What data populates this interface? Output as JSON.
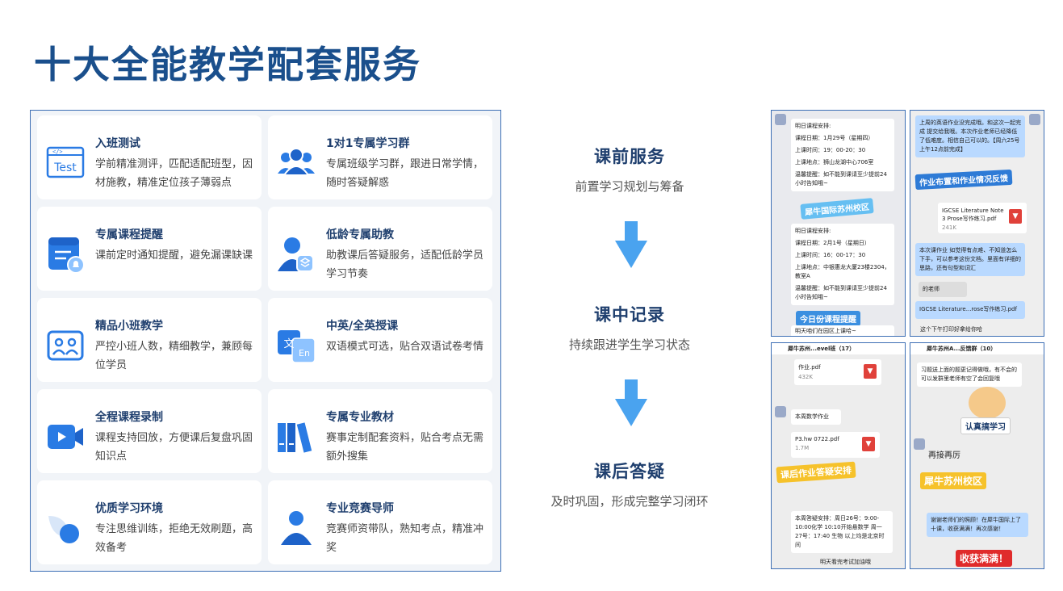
{
  "page": {
    "title": "十大全能教学配套服务"
  },
  "services": [
    {
      "title": "入班测试",
      "desc": "学前精准测评，匹配适配班型，因材施教，精准定位孩子薄弱点",
      "icon": "test-icon",
      "icon_text": "Test"
    },
    {
      "title": "1对1专属学习群",
      "desc": "专属班级学习群，跟进日常学情，随时答疑解惑",
      "icon": "group-icon"
    },
    {
      "title": "专属课程提醒",
      "desc": "课前定时通知提醒，避免漏课缺课",
      "icon": "calendar-bell-icon"
    },
    {
      "title": "低龄专属助教",
      "desc": "助教课后答疑服务，适配低龄学员学习节奏",
      "icon": "assistant-icon"
    },
    {
      "title": "精品小班教学",
      "desc": "严控小班人数，精细教学，兼顾每位学员",
      "icon": "small-class-icon"
    },
    {
      "title": "中英/全英授课",
      "desc": "双语模式可选，贴合双语试卷考情",
      "icon": "bilingual-icon",
      "icon_text_a": "文",
      "icon_text_b": "En"
    },
    {
      "title": "全程课程录制",
      "desc": "课程支持回放，方便课后复盘巩固知识点",
      "icon": "video-icon"
    },
    {
      "title": "专属专业教材",
      "desc": "赛事定制配套资料，贴合考点无需额外搜集",
      "icon": "books-icon"
    },
    {
      "title": "优质学习环境",
      "desc": "专注思维训练，拒绝无效刷题，高效备考",
      "icon": "environment-icon"
    },
    {
      "title": "专业竞赛导师",
      "desc": "竞赛师资带队，熟知考点，精准冲奖",
      "icon": "mentor-icon"
    }
  ],
  "flow": [
    {
      "title": "课前服务",
      "desc": "前置学习规划与筹备"
    },
    {
      "title": "课中记录",
      "desc": "持续跟进学生学习状态"
    },
    {
      "title": "课后答疑",
      "desc": "及时巩固，形成完整学习闭环"
    }
  ],
  "screenshots": {
    "shot1": {
      "msg1_head": "明日课程安排:",
      "msg1_date": "课程日期：1月29号（星期四）",
      "msg1_time": "上课时间：19：00-20：30",
      "msg1_place": "上课地点：狮山龙湖中心706室",
      "msg1_tip": "温馨提醒：如不能到课请至少提前24小时告知哦~",
      "sticker1": "犀牛国际苏州校区",
      "msg2_head": "明日课程安排:",
      "msg2_date": "课程日期：2月1号（星期日）",
      "msg2_time": "上课时间：16：00-17：30",
      "msg2_place": "上课地点：中银惠龙大厦23楼2304，教室A",
      "msg2_tip": "温馨提醒：如不能到课请至少提前24小时告知哦~",
      "sticker2": "今日份课程提醒",
      "footer": "明天咱们在园区上课哈~"
    },
    "shot2": {
      "msg1": "上周的英语作业没完成哦。和这次一起完成 提交给我哦。本次作业老师已经降低了低难度。相信自己可以的。【周六25号上午12点前完成】",
      "sticker": "作业布置和作业情况反馈",
      "file_name": "IGCSE Literature Note 3 Prose写作练习.pdf",
      "file_size": "241K",
      "msg2": "本次课作业 如觉得有点难、不知道怎么下手，可以参考这份文档。里面有详细的思路，还有句型和词汇",
      "msg3": "的老师",
      "file2": "IGCSE Literature...rose写作练习.pdf",
      "footer": "这个下午打印好拿给你哈"
    },
    "shot3": {
      "header": "犀牛苏州...evel班（17）",
      "file1": "作业.pdf",
      "file1_size": "432K",
      "msg1": "本周数学作业",
      "file2": "P3.hw 0722.pdf",
      "file2_size": "1.7M",
      "sticker": "课后作业答疑安排",
      "msg2": "本周答疑安排：周日26号：9:00-10:00化学 10:10开始悬数学 周一27号：17:40 生物 以上均是北京时间",
      "footer": "明天看完考试加油哦"
    },
    "shot4": {
      "header": "犀牛苏州A...反馈群（10）",
      "msg1": "习题送上面的题更记得做哦，有不会的可以发群里老师有空了会回复哦",
      "sticker1": "认真搞学习",
      "handwriting": "再接再厉",
      "sticker2": "犀牛苏州校区",
      "msg2": "谢谢老师们的照顾！在犀牛国际上了十课，收获满满！再次感谢！",
      "sticker3": "收获满满！"
    }
  },
  "colors": {
    "title": "#1a4f8c",
    "accent": "#2a7be4",
    "card_title": "#1f3f6e",
    "arrow": "#4aa3ef"
  }
}
